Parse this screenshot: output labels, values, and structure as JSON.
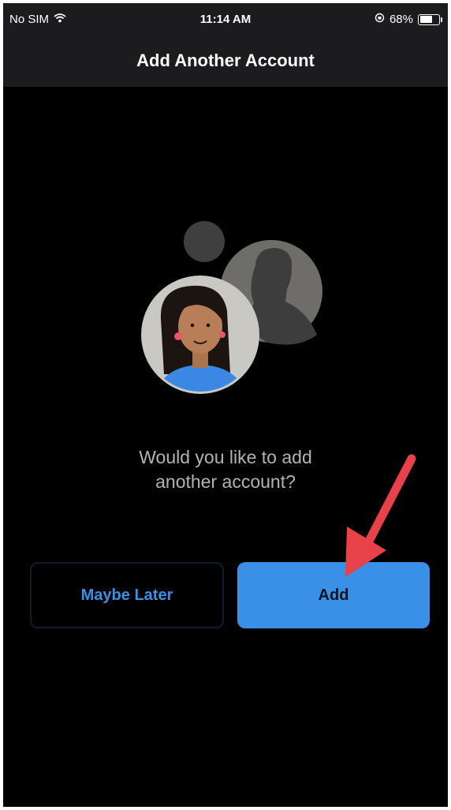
{
  "status_bar": {
    "carrier": "No SIM",
    "time": "11:14 AM",
    "battery_percent": "68%",
    "battery_level": 0.68,
    "icons": [
      "wifi-icon",
      "orientation-lock-icon",
      "battery-icon"
    ]
  },
  "nav": {
    "title": "Add Another Account"
  },
  "prompt": {
    "line1": "Would you like to add",
    "line2": "another account?"
  },
  "buttons": {
    "maybe_later": "Maybe Later",
    "add": "Add"
  },
  "colors": {
    "accent": "#3a8fe6",
    "background": "#000000",
    "nav_background": "#1c1c1e",
    "annotation_arrow": "#e8414a"
  }
}
